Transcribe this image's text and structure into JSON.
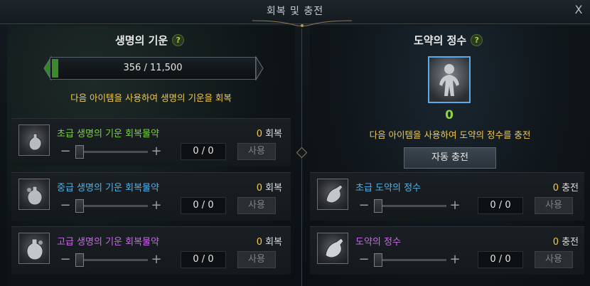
{
  "window": {
    "title": "회복 및 충전",
    "close_label": "X"
  },
  "life": {
    "title": "생명의 기운",
    "help": "?",
    "gauge": {
      "current": 356,
      "max": 11500,
      "text": "356 / 11,500"
    },
    "description": "다음 아이템을 사용하여 생명의 기운을 회복",
    "items": [
      {
        "name": "초급 생명의 기운 회복물약",
        "color": "#7bd43a",
        "count": "0",
        "unit": "회복",
        "qty": "0 / 0",
        "use": "사용"
      },
      {
        "name": "중급 생명의 기운 회복물약",
        "color": "#4fb3ea",
        "count": "0",
        "unit": "회복",
        "qty": "0 / 0",
        "use": "사용"
      },
      {
        "name": "고급 생명의 기운 회복물약",
        "color": "#c86ae8",
        "count": "0",
        "unit": "회복",
        "qty": "0 / 0",
        "use": "사용"
      }
    ]
  },
  "essence": {
    "title": "도약의 정수",
    "help": "?",
    "value": "0",
    "description": "다음 아이템을 사용하여 도약의 정수를 충전",
    "auto_button": "자동 충전",
    "items": [
      {
        "name": "초급 도약의 정수",
        "color": "#4fb3ea",
        "count": "0",
        "unit": "충전",
        "qty": "0 / 0",
        "use": "사용"
      },
      {
        "name": "도약의 정수",
        "color": "#c86ae8",
        "count": "0",
        "unit": "충전",
        "qty": "0 / 0",
        "use": "사용"
      }
    ]
  },
  "icons": {
    "close": "close-icon",
    "help": "help-icon",
    "minus": "minus-icon",
    "plus": "plus-icon",
    "potion": "potion-icon",
    "emblem": "essence-emblem-icon"
  }
}
